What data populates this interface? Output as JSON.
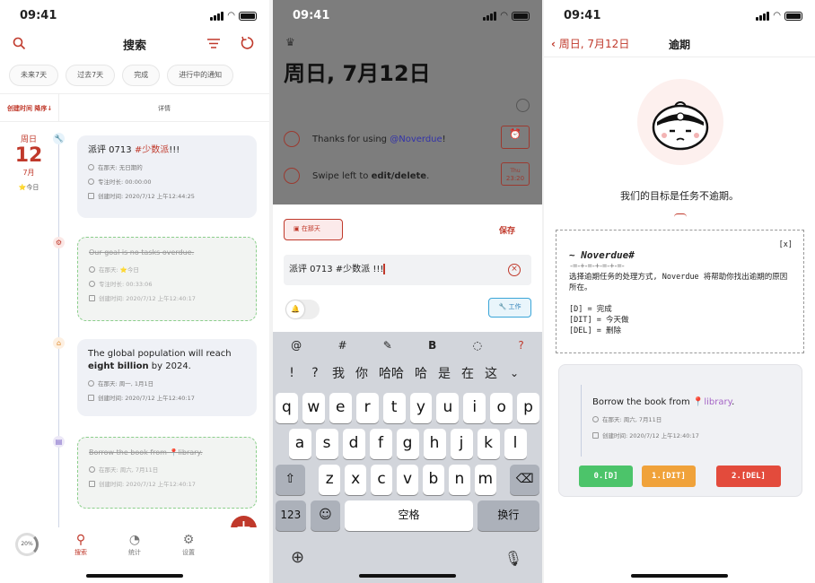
{
  "status": {
    "time": "09:41"
  },
  "screen1": {
    "nav_title": "搜索",
    "chips": [
      "未来7天",
      "过去7天",
      "完成",
      "进行中的通知"
    ],
    "sort_label": "创建时间 降序↓",
    "detail_label": "详情",
    "date": {
      "weekday": "周日",
      "day": "12",
      "month": "7月",
      "today": "⭐今日"
    },
    "cards": [
      {
        "title_prefix": "派评 0713 ",
        "tag": "#少数派",
        "title_suffix": "!!!",
        "meta": [
          "在那天: 无日期的",
          "专注时长: 00:00:00",
          "创建时间: 2020/7/12 上午12:44:25"
        ]
      },
      {
        "title": "Our goal is no tasks overdue.",
        "meta": [
          "在那天: ⭐今日",
          "专注时长: 00:33:06",
          "创建时间: 2020/7/12 上午12:40:17"
        ]
      },
      {
        "title_a": "The global population will reach ",
        "title_b": "eight billion",
        "title_c": " by 2024.",
        "meta": [
          "在那天: 周一, 1月1日",
          "创建时间: 2020/7/12 上午12:40:17"
        ]
      },
      {
        "title": "Borrow the book from 📍library.",
        "meta": [
          "在那天: 周六, 7月11日",
          "创建时间: 2020/7/12 上午12:40:17"
        ]
      }
    ],
    "progress": "20%",
    "tabs": [
      {
        "label": "搜索"
      },
      {
        "label": "统计"
      },
      {
        "label": "设置"
      }
    ]
  },
  "screen2": {
    "big_date": "周日, 7月12日",
    "rows": [
      {
        "text_a": "Thanks for using ",
        "text_b": "@Noverdue",
        "text_c": "!"
      },
      {
        "text_a": "Swipe left to ",
        "text_b": "edit/delete",
        "text_c": ".",
        "badge_top": "Thu",
        "badge_bottom": "23:20"
      }
    ],
    "date_button": "在那天",
    "save": "保存",
    "input_value": "派评 0713 #少数派 !!!",
    "work_tag": "工作",
    "suggestions": [
      "@",
      "#",
      "✎",
      "B",
      "◌",
      "?"
    ],
    "candidates": [
      "!",
      "?",
      "我",
      "你",
      "哈哈",
      "哈",
      "是",
      "在",
      "这"
    ],
    "row1": [
      "q",
      "w",
      "e",
      "r",
      "t",
      "y",
      "u",
      "i",
      "o",
      "p"
    ],
    "row2": [
      "a",
      "s",
      "d",
      "f",
      "g",
      "h",
      "j",
      "k",
      "l"
    ],
    "row3": [
      "z",
      "x",
      "c",
      "v",
      "b",
      "n",
      "m"
    ],
    "space": "空格",
    "return": "换行",
    "num": "123"
  },
  "screen3": {
    "back": "周日, 7月12日",
    "title": "逾期",
    "goal": "我们的目标是任务不逾期。",
    "term": {
      "close": "[x]",
      "heading": "~ Noverdue#",
      "dashes": "-=-+-=-+-=-+-=-",
      "desc": "选择逾期任务的处理方式, Noverdue 将帮助你找出逾期的原因所在。",
      "opt1": "[D] = 完成",
      "opt2": "[DIT] = 今天做",
      "opt3": "[DEL] = 删除"
    },
    "item_title_a": "Borrow the book from ",
    "item_title_b": "library",
    "item_title_c": ".",
    "item_meta": [
      "在那天: 周六, 7月11日",
      "创建时间: 2020/7/12 上午12:40:17"
    ],
    "buttons": [
      {
        "label": "0.[D]",
        "color": "#4cc46a"
      },
      {
        "label": "1.[DIT]",
        "color": "#f0a23a"
      },
      {
        "label": "2.[DEL]",
        "color": "#e34b3c"
      }
    ]
  }
}
